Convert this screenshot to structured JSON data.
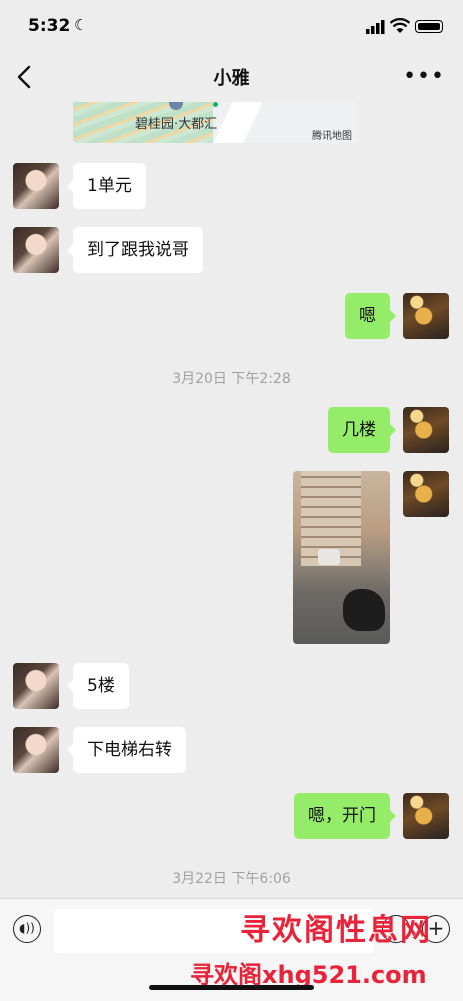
{
  "status_bar": {
    "time": "5:32"
  },
  "header": {
    "title": "小雅",
    "more": "•••"
  },
  "map_card": {
    "location": "碧桂园·大都汇",
    "provider": "腾讯地图"
  },
  "messages": [
    {
      "side": "in",
      "text": "1单元"
    },
    {
      "side": "in",
      "text": "到了跟我说哥"
    },
    {
      "side": "out",
      "text": "嗯"
    },
    {
      "type": "timestamp",
      "text": "3月20日 下午2:28"
    },
    {
      "side": "out",
      "text": "几楼"
    },
    {
      "side": "out",
      "type": "photo"
    },
    {
      "side": "in",
      "text": "5楼"
    },
    {
      "side": "in",
      "text": "下电梯右转"
    },
    {
      "side": "out",
      "text": "嗯，开门"
    },
    {
      "type": "timestamp",
      "text": "3月22日 下午6:06"
    }
  ],
  "input_bar": {
    "voice_icon": "voice-icon",
    "emoji_icon": "emoji-icon",
    "plus_icon": "plus-icon"
  },
  "watermark": {
    "line1": "寻欢阁性息网",
    "line2": "寻欢阁xhg521.com"
  }
}
